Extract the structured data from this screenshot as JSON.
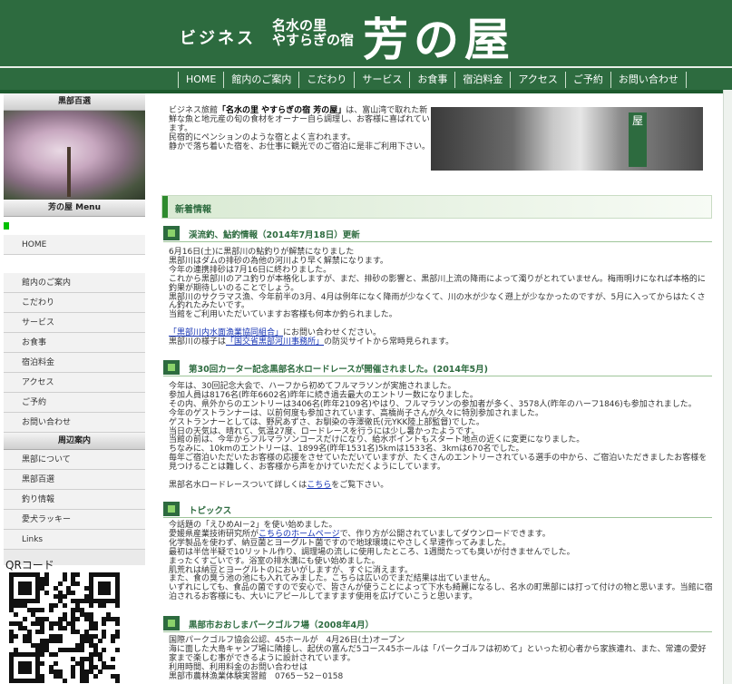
{
  "header": {
    "business": "ビジネス",
    "sub_line1": "名水の里",
    "sub_line2": "やすらぎの宿",
    "logo": "芳の屋",
    "nav": [
      "HOME",
      "館内のご案内",
      "こだわり",
      "サービス",
      "お食事",
      "宿泊料金",
      "アクセス",
      "ご予約",
      "お問い合わせ"
    ]
  },
  "sidebar": {
    "section1": "黒部百選",
    "section2": "芳の屋 Menu",
    "home": "HOME",
    "menu": [
      "館内のご案内",
      "こだわり",
      "サービス",
      "お食事",
      "宿泊料金",
      "アクセス",
      "ご予約",
      "お問い合わせ"
    ],
    "section3": "周辺案内",
    "links": [
      "黒部について",
      "黒部百選",
      "釣り情報",
      "愛犬ラッキー",
      "Links"
    ]
  },
  "qr": {
    "label": "QRコード"
  },
  "intro": {
    "prefix": "ビジネス旅館",
    "name": "「名水の里 やすらぎの宿 芳の屋」",
    "rest": "は、富山湾で取れた新鮮な魚と地元産の旬の食材をオーナー自ら調理し、お客様に喜ばれています。\n民宿的にペンションのような宿とよく言われます。\n静かで落ち着いた宿を、お仕事に観光でのご宿泊に是非ご利用下さい。",
    "sign": "屋"
  },
  "news": {
    "title": "新着情報",
    "s1_title": "渓流釣、鮎釣情報（2014年7月18日）更新",
    "s1_body": "6月16日(土)に黒部川の鮎釣りが解禁になりました\n黒部川はダムの排砂の為他の河川より早く解禁になります。\n今年の連携排砂は7月16日に終わりました。\nこれから黒部川のアユ釣りが本格化しますが、まだ、排砂の影響と、黒部川上流の降雨によって濁りがとれていません。梅雨明けになれば本格的に釣果が期待しいのることでしょう。\n黒部川のサクラマス漁、今年前半の3月、4月は例年になく降雨が少なくて、川の水が少なく遡上が少なかったのですが、5月に入ってからはたくさん釣れたみたいです。\n当館をご利用いただいていますお客様も何本か釣られました。",
    "s1_link1": "「黒部川内水面漁業協同組合」",
    "s1_after1": "にお問い合わせください。",
    "s1_pre2": "黒部川の様子は",
    "s1_link2": "「国交省黒部河川事務所」",
    "s1_after2": "の防災サイトから常時見られます。",
    "s2_title": "第30回カーター記念黒部名水ロードレースが開催されました。(2014年5月)",
    "s2_body": "今年は、30回記念大会で、ハーフから初めてフルマラソンが実施されました。\n参加人員は8176名(昨年6602名)昨年に続き過去最大のエントリー数になりました。\nその内、県外からのエントリーは3406名(昨年2109名)やはり、フルマラソンの参加者が多く、3578人(昨年のハーフ1846)も参加されました。\n今年のゲストランナーは、以前何度も参加されています、高橋尚子さんが久々に特別参加されました。\nゲストランナーとしては、野尻あずさ、お馴染の寺澤徹氏(元YKK陸上部監督)でした。\n当日の天気は、晴れて、気温27度、ロードレースを行うには少し暑かったようです。\n当館の前は、今年からフルマラソンコースだけになり、給水ポイントもスタート地点の近くに変更になりました。\nちなみに、10kmのエントリーは、1899名(昨年1531名)5kmは1533名、3kmは670名でした。\n毎年ご宿泊いただいたお客様の応援をさせていただいていますが、たくさんのエントリーされている選手の中から、ご宿泊いただきましたお客様を見つけることは難しく、お客様から声をかけていただくようにしています。",
    "s2_pre": "黒部名水ロードレースついて詳しくは",
    "s2_link": "こちら",
    "s2_after": "をご覧下さい。",
    "s3_title": "トピックス",
    "s3_l1": "今話題の「えひめAI－2」を使い始めました。",
    "s3_l2_pre": "愛媛県産業技術研究所が",
    "s3_l2_link": "こちらのホームページ",
    "s3_l2_after": "で、作り方が公開されていましてダウンロードできます。",
    "s3_rest": "化学製品を使わず、納豆菌とヨーグルト菌ですので地球環境にやさしく早速作ってみました。\n最初は半信半疑で10リットル作り、調理場の流しに使用したところ、1週間たっても臭いが付きませんでした。\nまったくすごいです。浴室の排水溝にも使い始めました。\n肌荒れは納豆とヨーグルトのにおいがしますが、すぐに消えます。\nまた、食の臭う池の池にも入れてみました。こちらは広いのでまだ結果は出ていません。\nいずれにしても、食品の菌ですので安心で、皆さんが使うことによって下水も綺麗になるし、名水の町黒部には打って付けの物と思います。当館に宿泊されるお客様にも、大いにアピールしてますます使用を広げていこうと思います。",
    "s4_title": "黒部市おおしまパークゴルフ場（2008年4月）",
    "s4_body": "国際パークゴルフ協会公認、45ホールが　4月26日(土)オープン\n海に面した大島キャンプ場に隣接し、起伏の富んだ5コース45ホールは「パークゴルフは初めて」といった初心者から家族連れ、また、常連の愛好家まで楽しむ事ができるように設計されています。\n利用時間、利用料金のお問い合わせは\n黒部市農林漁業体験実習館　0765－52－0158"
  }
}
